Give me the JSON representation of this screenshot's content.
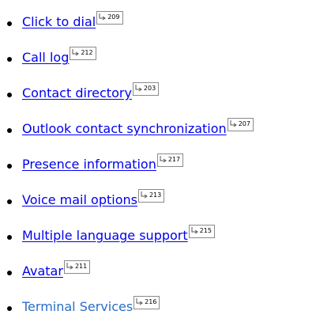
{
  "features": [
    {
      "label": "Click to dial",
      "page": "209"
    },
    {
      "label": "Call log",
      "page": "212"
    },
    {
      "label": "Contact directory",
      "page": "203"
    },
    {
      "label": "Outlook contact synchronization",
      "page": "207"
    },
    {
      "label": "Presence information",
      "page": "217"
    },
    {
      "label": "Voice mail options",
      "page": "213"
    },
    {
      "label": "Multiple language support",
      "page": "215"
    },
    {
      "label": "Avatar",
      "page": "211"
    },
    {
      "label": "Terminal Services",
      "page": "216"
    }
  ],
  "colors": {
    "link": "#0000ee",
    "last_link": "#2a6ec6",
    "bullet": "#000000",
    "page_ref_border": "#8a8a8a"
  },
  "icons": {
    "page_ref": "page-reference-arrow-icon"
  }
}
